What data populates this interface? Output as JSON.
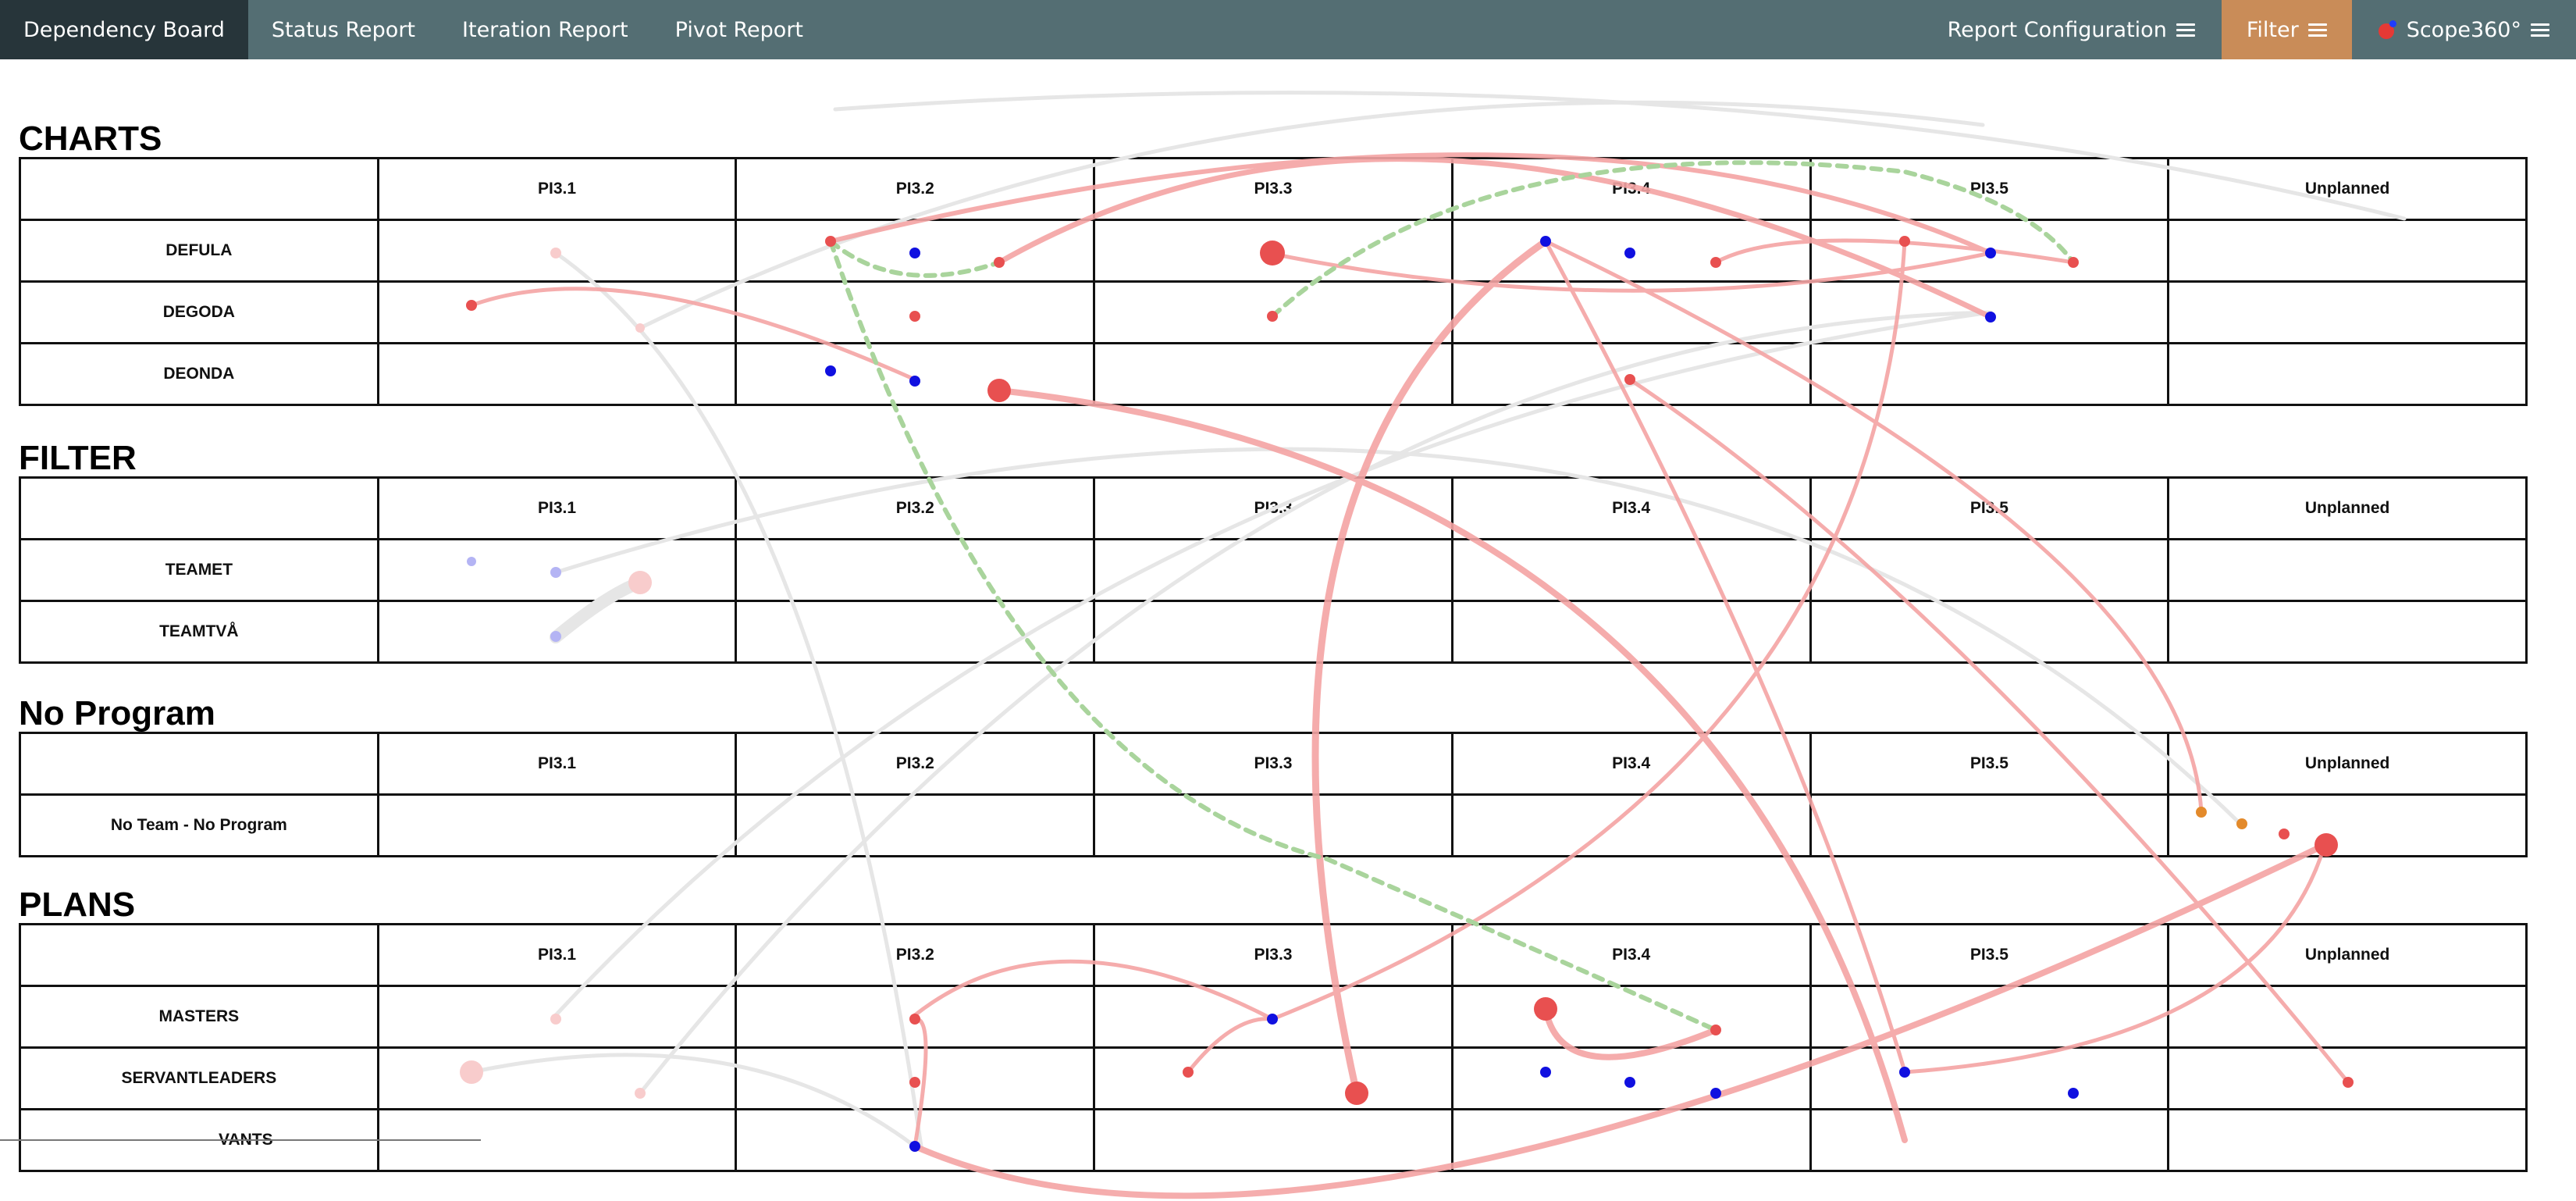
{
  "nav": {
    "tabs": [
      {
        "label": "Dependency Board",
        "active": true
      },
      {
        "label": "Status Report",
        "active": false
      },
      {
        "label": "Iteration Report",
        "active": false
      },
      {
        "label": "Pivot Report",
        "active": false
      }
    ],
    "report_config": "Report Configuration",
    "filter": "Filter",
    "scope": "Scope360°"
  },
  "columns": [
    "PI3.1",
    "PI3.2",
    "PI3.3",
    "PI3.4",
    "PI3.5",
    "Unplanned"
  ],
  "sections": [
    {
      "title": "CHARTS",
      "rows": [
        "DEFULA",
        "DEGODA",
        "DEONDA"
      ]
    },
    {
      "title": "FILTER",
      "rows": [
        "TEAMET",
        "TEAMTVÅ"
      ]
    },
    {
      "title": "No Program",
      "rows": [
        "No Team - No Program"
      ]
    },
    {
      "title": "PLANS",
      "rows": [
        "MASTERS",
        "SERVANTLEADERS",
        "VANTS"
      ]
    }
  ],
  "colors": {
    "nav_bg": "#546e73",
    "nav_active": "#27353a",
    "filter_bg": "#c98c58",
    "dependency_red": "#f4a4a4",
    "dependency_grey": "#e2e2e2",
    "dependency_green": "#a9d49c",
    "dot_red": "#e85050",
    "dot_blue": "#1010e0",
    "dot_orange": "#e38a2b"
  }
}
